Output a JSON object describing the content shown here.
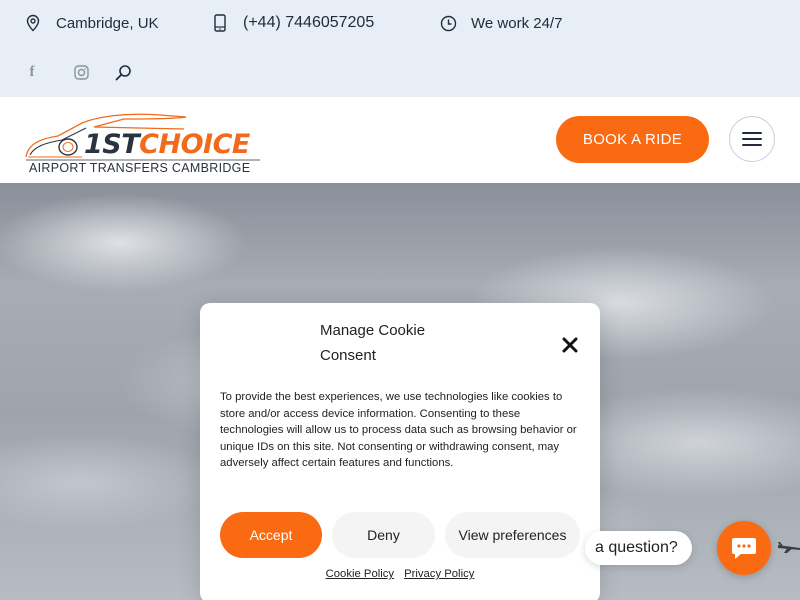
{
  "topbar": {
    "location": "Cambridge, UK",
    "phone": "(+44) 7446057205",
    "hours": "We work 24/7",
    "social": [
      "facebook-icon",
      "instagram-icon",
      "search-icon"
    ]
  },
  "header": {
    "logo_main_dark": "1ST",
    "logo_main_orange": "CHOICE",
    "logo_sub": "AIRPORT TRANSFERS CAMBRIDGE",
    "book_label": "BOOK A RIDE",
    "menu_icon": "hamburger-icon"
  },
  "cookie": {
    "title": "Manage Cookie Consent",
    "text": "To provide the best experiences, we use technologies like cookies to store and/or access device information. Consenting to these technologies will allow us to process data such as browsing behavior or unique IDs on this site. Not consenting or withdrawing consent, may adversely affect certain features and functions.",
    "accept": "Accept",
    "deny": "Deny",
    "preferences": "View preferences",
    "cookie_policy": "Cookie Policy",
    "privacy_policy": "Privacy Policy"
  },
  "chat": {
    "bubble": "a question?",
    "icon": "chat-icon"
  },
  "colors": {
    "accent": "#f96a12",
    "dark": "#222c3c",
    "topbar_bg": "#e8eef5"
  }
}
